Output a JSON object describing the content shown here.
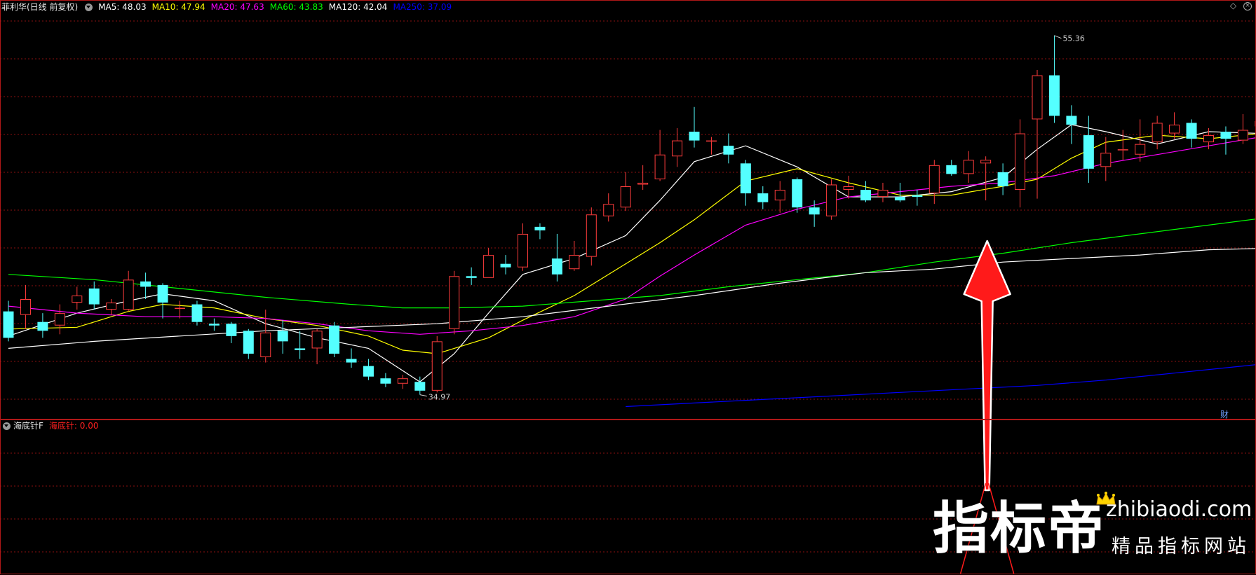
{
  "header": {
    "stock_name": "菲利华(日线 前复权)",
    "ma_labels": [
      {
        "text": "MA5: 48.03",
        "color": "#ffffff"
      },
      {
        "text": "MA10: 47.94",
        "color": "#ffff00"
      },
      {
        "text": "MA20: 47.63",
        "color": "#ff00ff"
      },
      {
        "text": "MA60: 43.83",
        "color": "#00ff00"
      },
      {
        "text": "MA120: 42.04",
        "color": "#ffffff"
      },
      {
        "text": "MA250: 37.09",
        "color": "#0000ff"
      }
    ]
  },
  "sub_panel": {
    "indicator_name": "海底针F",
    "value_label": "海底针: 0.00",
    "value_color": "#ff2020"
  },
  "annotations": {
    "high_label": "55.36",
    "low_label": "34.97",
    "finance_badge": "财"
  },
  "logo": {
    "brand": "指标帝",
    "url": "zhibiaodi.com",
    "tagline": "精品指标网站"
  },
  "colors": {
    "up": "#ff3c3c",
    "down": "#54ffff",
    "grid": "#8b1010",
    "frame": "#b01818",
    "arrow": "#ff1a1a"
  },
  "chart_data": {
    "type": "candlestick",
    "y_range": [
      34.0,
      56.5
    ],
    "high": 55.36,
    "low": 34.97,
    "candles": [
      [
        39.7,
        38.2,
        40.3,
        38.0
      ],
      [
        39.5,
        40.4,
        41.2,
        38.7
      ],
      [
        39.1,
        38.6,
        39.6,
        38.2
      ],
      [
        38.9,
        39.6,
        40.1,
        38.4
      ],
      [
        40.2,
        40.6,
        41.1,
        39.8
      ],
      [
        41.0,
        40.1,
        41.4,
        39.8
      ],
      [
        39.8,
        40.2,
        40.4,
        39.5
      ],
      [
        39.8,
        41.5,
        42.0,
        39.7
      ],
      [
        41.4,
        41.1,
        41.9,
        40.4
      ],
      [
        41.2,
        40.2,
        41.3,
        39.3
      ],
      [
        39.9,
        39.9,
        40.3,
        39.3
      ],
      [
        40.1,
        39.1,
        40.3,
        38.9
      ],
      [
        39.0,
        38.9,
        39.3,
        38.6
      ],
      [
        39.0,
        38.3,
        39.1,
        37.9
      ],
      [
        38.6,
        37.3,
        38.7,
        37.0
      ],
      [
        37.1,
        38.5,
        39.8,
        36.8
      ],
      [
        38.6,
        38.0,
        39.2,
        37.3
      ],
      [
        37.6,
        37.5,
        38.6,
        37.0
      ],
      [
        37.6,
        38.6,
        38.7,
        36.7
      ],
      [
        38.9,
        37.3,
        39.1,
        37.1
      ],
      [
        37.0,
        36.8,
        37.6,
        36.5
      ],
      [
        36.6,
        36.0,
        37.0,
        35.8
      ],
      [
        35.9,
        35.6,
        36.2,
        35.4
      ],
      [
        35.6,
        35.9,
        36.1,
        35.3
      ],
      [
        35.7,
        35.2,
        36.0,
        34.97
      ],
      [
        35.2,
        38.0,
        38.3,
        35.1
      ],
      [
        38.7,
        41.7,
        42.0,
        38.4
      ],
      [
        41.7,
        41.6,
        42.2,
        41.2
      ],
      [
        41.6,
        42.9,
        43.3,
        41.6
      ],
      [
        42.4,
        42.2,
        42.9,
        41.8
      ],
      [
        42.2,
        44.1,
        44.7,
        42.0
      ],
      [
        44.5,
        44.3,
        44.7,
        43.8
      ],
      [
        42.7,
        41.8,
        44.1,
        41.4
      ],
      [
        42.1,
        42.9,
        43.7,
        42.0
      ],
      [
        42.8,
        45.2,
        45.6,
        42.3
      ],
      [
        45.1,
        45.8,
        46.4,
        44.8
      ],
      [
        45.6,
        46.8,
        47.6,
        45.4
      ],
      [
        46.9,
        47.0,
        48.0,
        46.6
      ],
      [
        47.2,
        48.6,
        50.0,
        47.1
      ],
      [
        48.5,
        49.4,
        50.1,
        47.9
      ],
      [
        49.9,
        49.4,
        51.3,
        49.0
      ],
      [
        49.4,
        49.4,
        49.6,
        48.6
      ],
      [
        49.1,
        48.6,
        49.8,
        48.1
      ],
      [
        48.1,
        46.4,
        48.3,
        45.7
      ],
      [
        46.4,
        45.9,
        46.8,
        45.5
      ],
      [
        46.0,
        46.6,
        47.1,
        45.3
      ],
      [
        47.2,
        45.6,
        47.3,
        45.3
      ],
      [
        45.6,
        45.2,
        46.0,
        44.5
      ],
      [
        45.1,
        46.9,
        47.2,
        44.9
      ],
      [
        46.6,
        46.8,
        47.4,
        46.1
      ],
      [
        46.6,
        46.0,
        47.1,
        45.9
      ],
      [
        46.2,
        46.6,
        47.0,
        45.9
      ],
      [
        46.2,
        46.0,
        47.0,
        45.9
      ],
      [
        46.3,
        46.2,
        46.6,
        45.7
      ],
      [
        46.4,
        48.0,
        48.3,
        45.8
      ],
      [
        48.0,
        47.5,
        48.3,
        47.4
      ],
      [
        47.5,
        48.3,
        48.8,
        47.0
      ],
      [
        48.1,
        48.3,
        48.5,
        46.0
      ],
      [
        47.6,
        46.8,
        48.1,
        46.3
      ],
      [
        46.6,
        49.8,
        50.6,
        45.6
      ],
      [
        50.6,
        53.1,
        53.4,
        46.1
      ],
      [
        53.1,
        50.8,
        55.36,
        50.4
      ],
      [
        50.8,
        50.3,
        51.4,
        49.2
      ],
      [
        49.7,
        47.8,
        50.8,
        47.0
      ],
      [
        47.9,
        48.7,
        49.6,
        47.1
      ],
      [
        48.9,
        48.9,
        50.0,
        48.3
      ],
      [
        48.6,
        49.2,
        50.6,
        48.2
      ],
      [
        49.3,
        50.4,
        50.8,
        48.9
      ],
      [
        49.8,
        50.3,
        51.0,
        49.5
      ],
      [
        50.4,
        49.5,
        50.6,
        49.0
      ],
      [
        49.3,
        49.7,
        50.1,
        48.9
      ],
      [
        49.9,
        49.5,
        50.2,
        48.6
      ],
      [
        49.4,
        50.0,
        50.9,
        49.2
      ],
      [
        50.2,
        50.5,
        50.8,
        50.0
      ],
      [
        50.3,
        51.0,
        51.1,
        49.7
      ]
    ],
    "ma_lines": [
      {
        "name": "MA5",
        "color": "#ffffff",
        "points": [
          [
            0,
            38.3
          ],
          [
            4,
            39.6
          ],
          [
            7,
            40.3
          ],
          [
            9,
            40.7
          ],
          [
            12,
            40.3
          ],
          [
            15,
            39.0
          ],
          [
            18,
            38.2
          ],
          [
            21,
            37.6
          ],
          [
            24,
            35.7
          ],
          [
            26,
            37.3
          ],
          [
            28,
            39.6
          ],
          [
            30,
            41.8
          ],
          [
            33,
            42.7
          ],
          [
            36,
            44.0
          ],
          [
            38,
            46.0
          ],
          [
            40,
            48.2
          ],
          [
            43,
            49.1
          ],
          [
            46,
            47.9
          ],
          [
            49,
            46.2
          ],
          [
            52,
            46.2
          ],
          [
            55,
            46.5
          ],
          [
            58,
            47.3
          ],
          [
            60,
            48.9
          ],
          [
            62,
            50.3
          ],
          [
            64,
            49.9
          ],
          [
            67,
            49.2
          ],
          [
            70,
            49.9
          ],
          [
            73,
            49.8
          ],
          [
            74,
            49.9
          ]
        ]
      },
      {
        "name": "MA10",
        "color": "#ffff00",
        "points": [
          [
            0,
            38.7
          ],
          [
            4,
            38.8
          ],
          [
            7,
            39.7
          ],
          [
            9,
            40.1
          ],
          [
            12,
            39.9
          ],
          [
            15,
            39.3
          ],
          [
            18,
            38.9
          ],
          [
            21,
            38.3
          ],
          [
            23,
            37.5
          ],
          [
            25,
            37.3
          ],
          [
            28,
            38.2
          ],
          [
            30,
            39.2
          ],
          [
            33,
            40.6
          ],
          [
            36,
            42.4
          ],
          [
            38,
            43.6
          ],
          [
            40,
            44.9
          ],
          [
            43,
            47.1
          ],
          [
            46,
            47.8
          ],
          [
            49,
            47.0
          ],
          [
            52,
            46.3
          ],
          [
            55,
            46.3
          ],
          [
            58,
            46.8
          ],
          [
            60,
            47.2
          ],
          [
            62,
            48.4
          ],
          [
            64,
            49.3
          ],
          [
            67,
            49.7
          ],
          [
            70,
            49.5
          ],
          [
            73,
            49.8
          ],
          [
            74,
            50.0
          ]
        ]
      },
      {
        "name": "MA20",
        "color": "#ff00ff",
        "points": [
          [
            0,
            40.0
          ],
          [
            4,
            39.6
          ],
          [
            8,
            39.4
          ],
          [
            12,
            39.4
          ],
          [
            15,
            39.3
          ],
          [
            18,
            39.0
          ],
          [
            21,
            38.6
          ],
          [
            24,
            38.4
          ],
          [
            27,
            38.6
          ],
          [
            30,
            38.9
          ],
          [
            33,
            39.4
          ],
          [
            36,
            40.4
          ],
          [
            38,
            41.7
          ],
          [
            40,
            42.9
          ],
          [
            43,
            44.6
          ],
          [
            46,
            45.5
          ],
          [
            49,
            46.2
          ],
          [
            52,
            46.5
          ],
          [
            55,
            46.8
          ],
          [
            58,
            47.0
          ],
          [
            61,
            47.4
          ],
          [
            64,
            48.1
          ],
          [
            67,
            48.6
          ],
          [
            70,
            49.1
          ],
          [
            73,
            49.6
          ],
          [
            74,
            49.8
          ]
        ]
      },
      {
        "name": "MA60",
        "color": "#00ff00",
        "points": [
          [
            0,
            41.8
          ],
          [
            5,
            41.5
          ],
          [
            10,
            41.0
          ],
          [
            15,
            40.5
          ],
          [
            20,
            40.1
          ],
          [
            23,
            39.9
          ],
          [
            26,
            39.9
          ],
          [
            30,
            40.0
          ],
          [
            34,
            40.3
          ],
          [
            38,
            40.6
          ],
          [
            42,
            41.1
          ],
          [
            46,
            41.5
          ],
          [
            50,
            41.9
          ],
          [
            54,
            42.5
          ],
          [
            58,
            43.0
          ],
          [
            62,
            43.6
          ],
          [
            66,
            44.1
          ],
          [
            70,
            44.6
          ],
          [
            74,
            45.1
          ]
        ]
      },
      {
        "name": "MA120",
        "color": "#ffffff",
        "points": [
          [
            0,
            37.6
          ],
          [
            5,
            38.0
          ],
          [
            10,
            38.3
          ],
          [
            15,
            38.6
          ],
          [
            20,
            38.8
          ],
          [
            25,
            39.0
          ],
          [
            30,
            39.4
          ],
          [
            35,
            40.0
          ],
          [
            40,
            40.6
          ],
          [
            45,
            41.3
          ],
          [
            50,
            41.9
          ],
          [
            54,
            42.1
          ],
          [
            58,
            42.5
          ],
          [
            62,
            42.7
          ],
          [
            66,
            42.9
          ],
          [
            70,
            43.2
          ],
          [
            74,
            43.3
          ]
        ]
      },
      {
        "name": "MA250",
        "color": "#0000ff",
        "points": [
          [
            36,
            34.3
          ],
          [
            40,
            34.5
          ],
          [
            44,
            34.7
          ],
          [
            48,
            34.9
          ],
          [
            52,
            35.1
          ],
          [
            56,
            35.3
          ],
          [
            60,
            35.5
          ],
          [
            64,
            35.8
          ],
          [
            68,
            36.2
          ],
          [
            72,
            36.6
          ],
          [
            74,
            36.8
          ]
        ]
      }
    ]
  }
}
